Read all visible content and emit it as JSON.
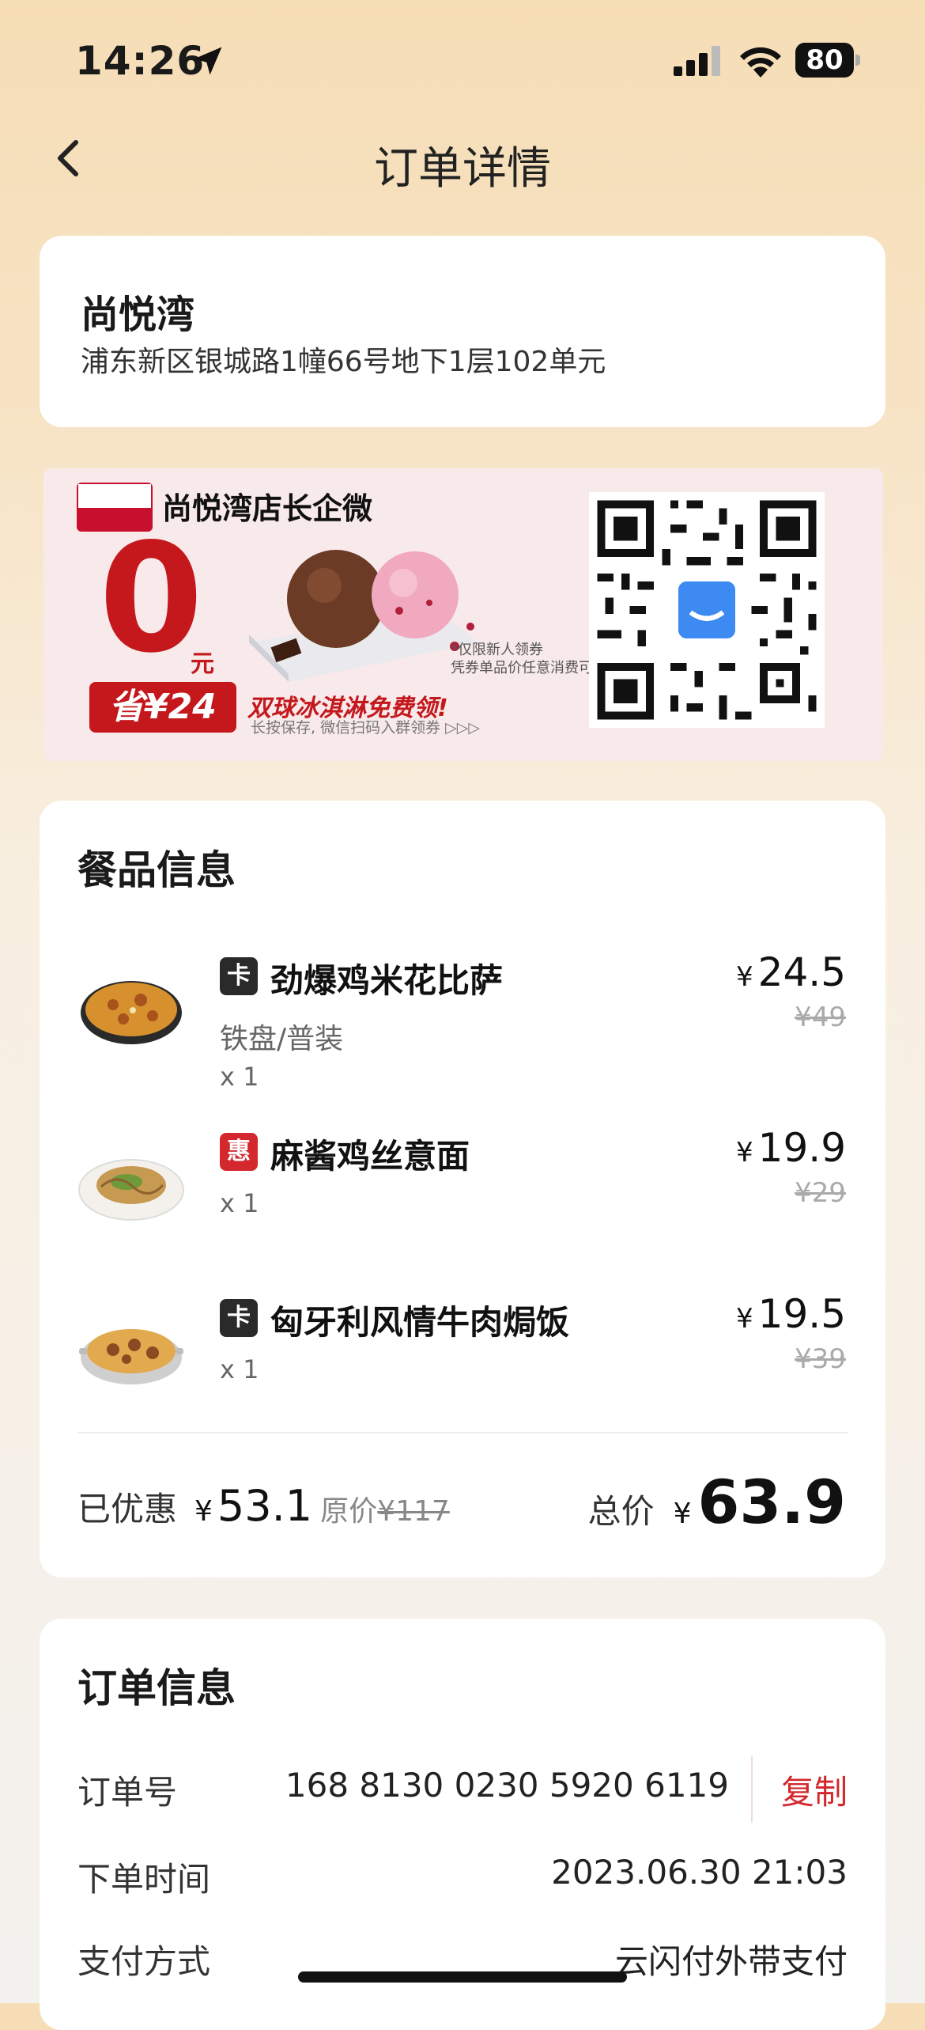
{
  "status_bar": {
    "time": "14:26",
    "battery": "80"
  },
  "nav": {
    "title": "订单详情"
  },
  "store": {
    "name": "尚悦湾",
    "address": "浦东新区银城路1幢66号地下1层102单元"
  },
  "banner": {
    "title": "尚悦湾店长企微",
    "big_number": "0",
    "unit": "元",
    "save_text": "省¥24",
    "promo_main": "双球冰淇淋免费领!",
    "promo_sub": "长按保存, 微信扫码入群领券 ▷▷▷",
    "note_line1": "*仅限新人领券",
    "note_line2": "凭券单品价任意消费可"
  },
  "food": {
    "section_title": "餐品信息",
    "currency": "¥",
    "items": [
      {
        "tag": "卡",
        "tag_type": "card",
        "name": "劲爆鸡米花比萨",
        "spec": "铁盘/普装",
        "qty": "x 1",
        "price": "24.5",
        "orig_price": "¥49"
      },
      {
        "tag": "惠",
        "tag_type": "discount",
        "name": "麻酱鸡丝意面",
        "spec": "",
        "qty": "x 1",
        "price": "19.9",
        "orig_price": "¥29"
      },
      {
        "tag": "卡",
        "tag_type": "card",
        "name": "匈牙利风情牛肉焗饭",
        "spec": "",
        "qty": "x 1",
        "price": "19.5",
        "orig_price": "¥39"
      }
    ],
    "summary": {
      "discount_label": "已优惠",
      "discount_amount": "53.1",
      "orig_label": "原价",
      "orig_amount": "¥117",
      "total_label": "总价",
      "total_amount": "63.9"
    }
  },
  "order": {
    "section_title": "订单信息",
    "rows": [
      {
        "label": "订单号",
        "value": "168 8130 0230 5920 6119",
        "action": "复制"
      },
      {
        "label": "下单时间",
        "value": "2023.06.30 21:03"
      },
      {
        "label": "支付方式",
        "value": "云闪付外带支付"
      }
    ]
  },
  "colors": {
    "accent_red": "#d3282e",
    "brand_red": "#c4181c",
    "bg_top": "#f6ddb6"
  }
}
